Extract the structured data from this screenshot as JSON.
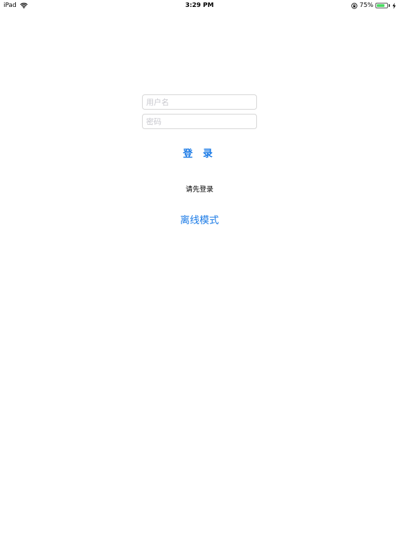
{
  "status_bar": {
    "device": "iPad",
    "time": "3:29 PM",
    "battery_percent": "75%",
    "battery_level": 0.75,
    "icons": [
      "wifi-icon",
      "rotation-lock-icon",
      "battery-icon",
      "charging-bolt-icon"
    ],
    "battery_color": "#4cd964"
  },
  "login": {
    "username_placeholder": "用户名",
    "password_placeholder": "密码",
    "login_label": "登 录",
    "prompt": "请先登录",
    "offline_label": "离线模式"
  },
  "colors": {
    "accent": "#1a7ae6",
    "field_border": "#d6d6d6",
    "placeholder": "#c7c7cd"
  }
}
